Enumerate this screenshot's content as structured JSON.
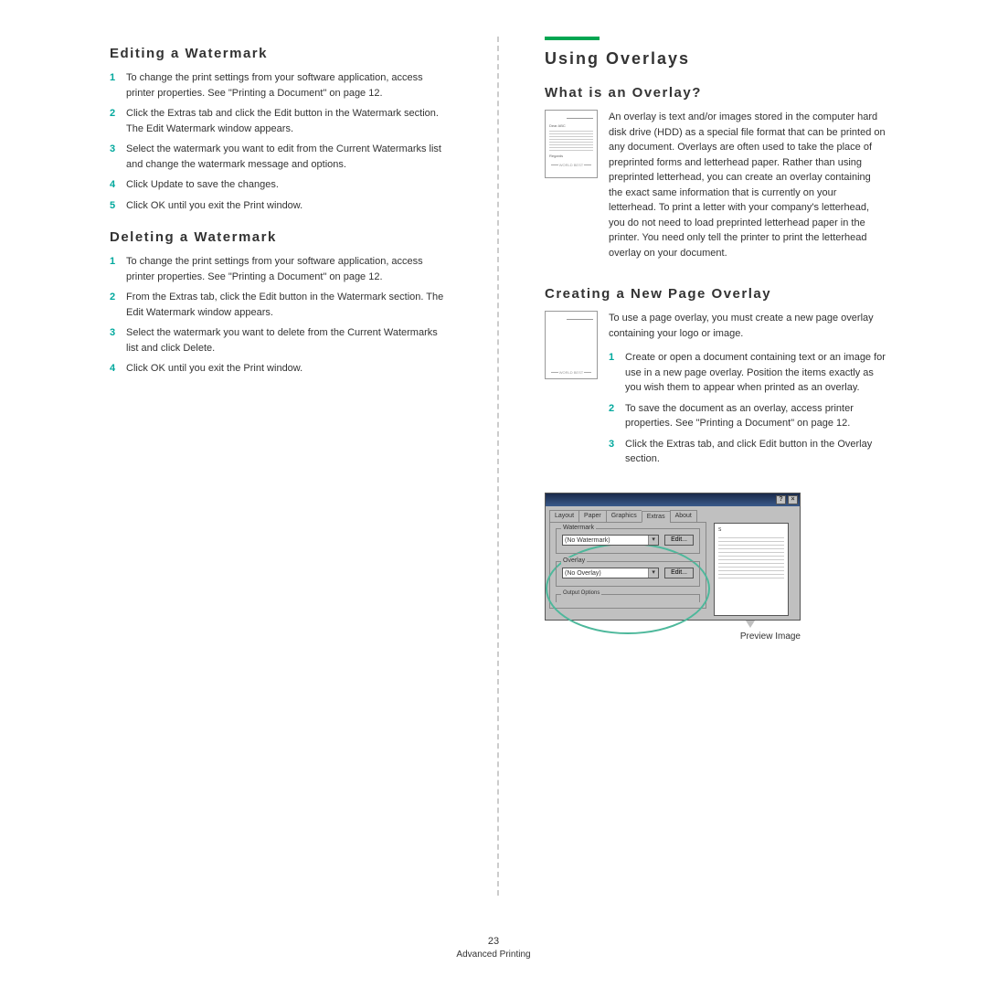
{
  "left": {
    "editing": {
      "heading": "Editing a Watermark",
      "steps": [
        "To change the print settings from your software application, access printer properties. See \"Printing a Document\" on page 12.",
        "Click the Extras tab and click the Edit button in the Watermark section. The Edit Watermark window appears.",
        "Select the watermark you want to edit from the Current Watermarks list and change the watermark message and options.",
        "Click Update to save the changes.",
        "Click OK until you exit the Print window."
      ]
    },
    "deleting": {
      "heading": "Deleting a Watermark",
      "steps": [
        "To change the print settings from your software application, access printer properties. See \"Printing a Document\" on page 12.",
        "From the Extras tab, click the Edit button in the Watermark section. The Edit Watermark window appears.",
        "Select the watermark you want to delete from the Current Watermarks list and click Delete.",
        "Click OK until you exit the Print window."
      ]
    }
  },
  "right": {
    "main_heading": "Using Overlays",
    "what_is": {
      "heading": "What is an Overlay?",
      "body": "An overlay is text and/or images stored in the computer hard disk drive (HDD) as a special file format that can be printed on any document. Overlays are often used to take the place of preprinted forms and letterhead paper. Rather than using preprinted letterhead, you can create an overlay containing the exact same information that is currently on your letterhead. To print a letter with your company's letterhead, you do not need to load preprinted letterhead paper in the printer. You need only tell the printer to print the letterhead overlay on your document."
    },
    "creating": {
      "heading": "Creating a New Page Overlay",
      "intro": "To use a page overlay, you must create a new page overlay containing your logo or image.",
      "steps": [
        "Create or open a document containing text or an image for use in a new page overlay. Position the items exactly as you wish them to appear when printed as an overlay.",
        "To save the document as an overlay, access printer properties. See \"Printing a Document\" on page 12.",
        "Click the Extras tab, and click Edit button in the Overlay section."
      ]
    },
    "illustration": {
      "dear": "Dear ABC",
      "regards": "Regards",
      "banner": "WORLD BEST"
    },
    "dialog": {
      "tabs": [
        "Layout",
        "Paper",
        "Graphics",
        "Extras",
        "About"
      ],
      "watermark_legend": "Watermark",
      "watermark_value": "(No Watermark)",
      "overlay_legend": "Overlay",
      "overlay_value": "(No Overlay)",
      "edit_btn": "Edit...",
      "output_legend": "Output Options",
      "preview_s": "S",
      "help_btn": "?",
      "close_btn": "×"
    },
    "callout": "Preview Image"
  },
  "footer": {
    "page": "23",
    "section": "Advanced Printing"
  }
}
